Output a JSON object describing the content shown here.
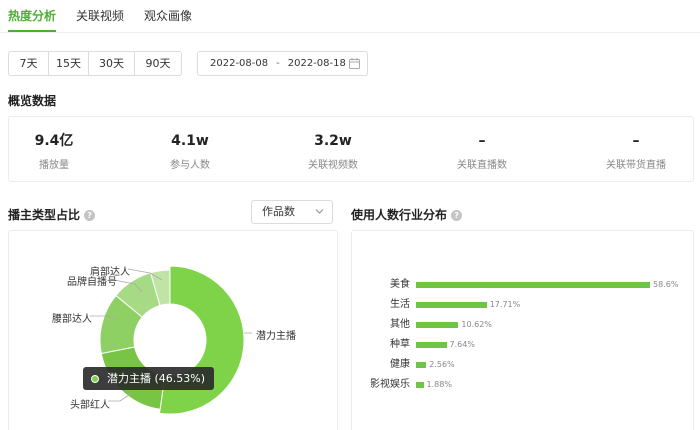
{
  "tabs": [
    {
      "label": "热度分析",
      "active": true
    },
    {
      "label": "关联视频",
      "active": false
    },
    {
      "label": "观众画像",
      "active": false
    }
  ],
  "time_ranges": [
    "7天",
    "15天",
    "30天",
    "90天"
  ],
  "date_range": {
    "start": "2022-08-08",
    "separator": "-",
    "end": "2022-08-18",
    "icon": "calendar-icon"
  },
  "overview": {
    "title": "概览数据",
    "metrics": [
      {
        "value": "9.4亿",
        "label": "播放量"
      },
      {
        "value": "4.1w",
        "label": "参与人数"
      },
      {
        "value": "3.2w",
        "label": "关联视频数"
      },
      {
        "value": "–",
        "label": "关联直播数"
      },
      {
        "value": "–",
        "label": "关联带货直播"
      }
    ]
  },
  "anchor_type": {
    "title": "播主类型占比",
    "help_icon": "question-circle-icon",
    "select_value": "作品数",
    "tooltip": "潜力主播 (46.53%)",
    "colors": {
      "primary": "#7ed348",
      "tooltip_bg": "#2b2b2b"
    }
  },
  "industry": {
    "title": "使用人数行业分布",
    "help_icon": "question-circle-icon"
  },
  "chart_data": [
    {
      "type": "pie",
      "variant": "donut",
      "slices": [
        {
          "label": "潜力主播",
          "value": 46.53
        },
        {
          "label": "头部红人",
          "value": 17.5
        },
        {
          "label": "腰部达人",
          "value": 12.5
        },
        {
          "label": "品牌自播号",
          "value": 8.5
        },
        {
          "label": "肩部达人",
          "value": 4.0
        }
      ],
      "colors": [
        "#7ed348",
        "#78c546",
        "#8fd065",
        "#a6da85",
        "#bfe4a6"
      ]
    },
    {
      "type": "bar",
      "orientation": "horizontal",
      "categories": [
        "美食",
        "生活",
        "其他",
        "种草",
        "健康",
        "影视娱乐"
      ],
      "values": [
        58.6,
        17.71,
        10.62,
        7.64,
        2.56,
        1.88
      ],
      "value_labels": [
        "58.6%",
        "17.71%",
        "10.62%",
        "7.64%",
        "2.56%",
        "1.88%"
      ],
      "color": "#6cc644"
    }
  ]
}
